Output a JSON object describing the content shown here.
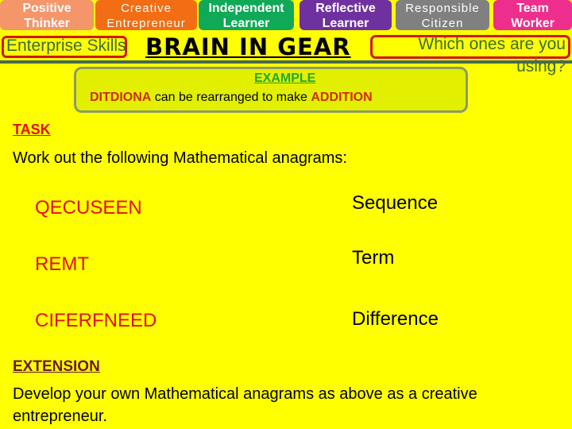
{
  "skills_bar": {
    "items": [
      {
        "line1": "Positive",
        "line2": "Thinker",
        "color": "#f4956a"
      },
      {
        "line1": "Creative",
        "line2": "Entrepreneur",
        "color": "#f26d14"
      },
      {
        "line1": "Independent",
        "line2": "Learner",
        "color": "#0fa958"
      },
      {
        "line1": "Reflective",
        "line2": "Learner",
        "color": "#7031a0"
      },
      {
        "line1": "Responsible",
        "line2": "Citizen",
        "color": "#808080"
      },
      {
        "line1": "Team",
        "line2": "Worker",
        "color": "#ee2e8c"
      }
    ]
  },
  "header": {
    "enterprise_label": "Enterprise Skills",
    "title": "BRAIN IN GEAR",
    "question_line1": "Which ones are you",
    "question_line2": "using?"
  },
  "example": {
    "heading": "EXAMPLE",
    "scrambled": "DITDIONA",
    "middle_text": " can be rearranged to make ",
    "answer": "ADDITION"
  },
  "task": {
    "heading": "TASK",
    "instruction": "Work out the following Mathematical anagrams:",
    "anagrams": [
      {
        "scrambled": "QECUSEEN",
        "answer": "Sequence"
      },
      {
        "scrambled": "REMT",
        "answer": "Term"
      },
      {
        "scrambled": "CIFERFNEED",
        "answer": "Difference"
      }
    ]
  },
  "extension": {
    "heading": "EXTENSION",
    "text": "Develop your own Mathematical anagrams as above as a creative entrepreneur."
  },
  "colors": {
    "background": "#ffff00",
    "accent_red": "#e01010",
    "example_green": "#22a82c",
    "divider": "#476b52"
  }
}
